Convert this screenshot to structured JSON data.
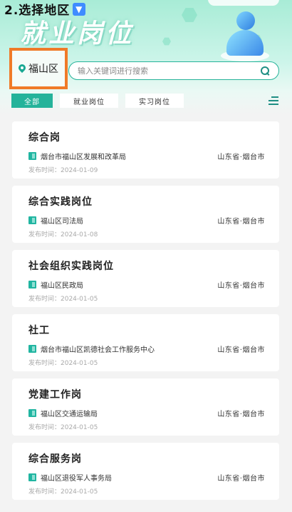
{
  "step": {
    "label": "2.选择地区",
    "icon": "down-arrow-icon"
  },
  "hero": {
    "title": "就业岗位"
  },
  "district": {
    "label": "福山区",
    "icon": "location-pin-icon"
  },
  "search": {
    "placeholder": "输入关键词进行搜索",
    "value": "",
    "icon": "search-icon"
  },
  "tabs": [
    {
      "label": "全部",
      "active": true
    },
    {
      "label": "就业岗位",
      "active": false
    },
    {
      "label": "实习岗位",
      "active": false
    }
  ],
  "jobs": [
    {
      "title": "综合岗",
      "org": "烟台市福山区发展和改革局",
      "location": "山东省·烟台市",
      "date": "发布时间：2024-01-09"
    },
    {
      "title": "综合实践岗位",
      "org": "福山区司法局",
      "location": "山东省·烟台市",
      "date": "发布时间：2024-01-08"
    },
    {
      "title": "社会组织实践岗位",
      "org": "福山区民政局",
      "location": "山东省·烟台市",
      "date": "发布时间：2024-01-05"
    },
    {
      "title": "社工",
      "org": "烟台市福山区凯德社会工作服务中心",
      "location": "山东省·烟台市",
      "date": "发布时间：2024-01-05"
    },
    {
      "title": "党建工作岗",
      "org": "福山区交通运输局",
      "location": "山东省·烟台市",
      "date": "发布时间：2024-01-05"
    },
    {
      "title": "综合服务岗",
      "org": "福山区退役军人事务局",
      "location": "山东省·烟台市",
      "date": "发布时间：2024-01-05"
    }
  ],
  "colors": {
    "accent": "#24b39a",
    "highlight": "#f07a28",
    "step_icon": "#3f8cff"
  }
}
